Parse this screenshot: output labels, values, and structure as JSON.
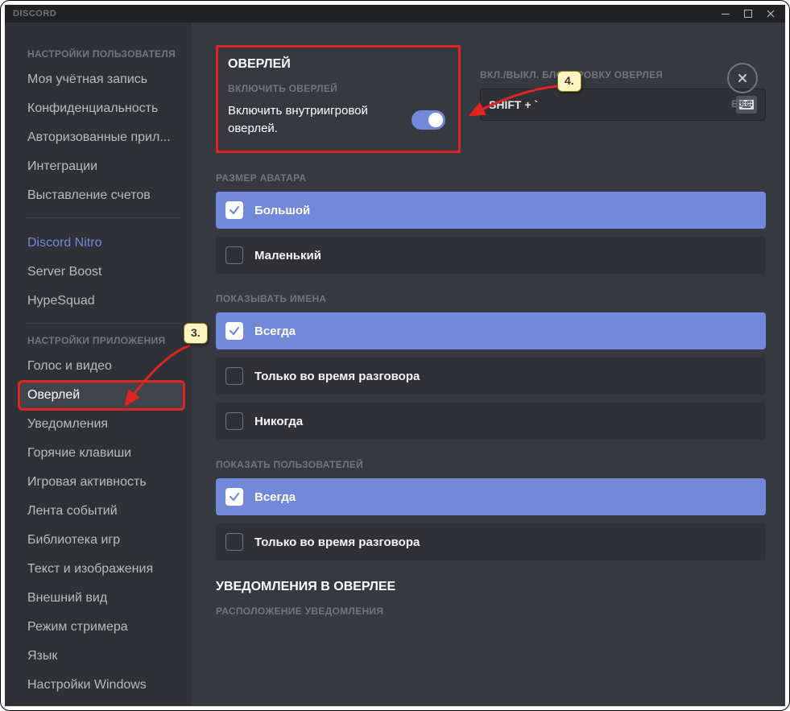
{
  "app_name": "DISCORD",
  "esc_label": "ESC",
  "sidebar": {
    "header_user": "НАСТРОЙКИ ПОЛЬЗОВАТЕЛЯ",
    "user_items": [
      "Моя учётная запись",
      "Конфиденциальность",
      "Авторизованные прил...",
      "Интеграции",
      "Выставление счетов"
    ],
    "premium_items": [
      "Discord Nitro",
      "Server Boost",
      "HypeSquad"
    ],
    "header_app": "НАСТРОЙКИ ПРИЛОЖЕНИЯ",
    "app_items": [
      "Голос и видео",
      "Оверлей",
      "Уведомления",
      "Горячие клавиши",
      "Игровая активность",
      "Лента событий",
      "Библиотека игр",
      "Текст и изображения",
      "Внешний вид",
      "Режим стримера",
      "Язык",
      "Настройки Windows"
    ],
    "active_app_item_index": 1
  },
  "overlay_section": {
    "title": "ОВЕРЛЕЙ",
    "enable_label": "ВКЛЮЧИТЬ ОВЕРЛЕЙ",
    "enable_description": "Включить внутриигровой оверлей.",
    "enable_value": true,
    "lock_label": "ВКЛ./ВЫКЛ. БЛОКИРОВКУ ОВЕРЛЕЯ",
    "keybind": "SHIFT + `"
  },
  "avatar_size": {
    "label": "РАЗМЕР АВАТАРА",
    "options": [
      "Большой",
      "Маленький"
    ],
    "selected_index": 0
  },
  "show_names": {
    "label": "ПОКАЗЫВАТЬ ИМЕНА",
    "options": [
      "Всегда",
      "Только во время разговора",
      "Никогда"
    ],
    "selected_index": 0
  },
  "show_users": {
    "label": "ПОКАЗАТЬ ПОЛЬЗОВАТЕЛЕЙ",
    "options": [
      "Всегда",
      "Только во время разговора"
    ],
    "selected_index": 0
  },
  "notifications": {
    "title": "УВЕДОМЛЕНИЯ В ОВЕРЛЕЕ",
    "position_label": "РАСПОЛОЖЕНИЕ УВЕДОМЛЕНИЯ"
  },
  "annotations": {
    "callout_3": "3.",
    "callout_4": "4."
  },
  "colors": {
    "accent": "#7289da",
    "highlight_border": "#e02323",
    "callout_bg": "#fff5c2"
  }
}
